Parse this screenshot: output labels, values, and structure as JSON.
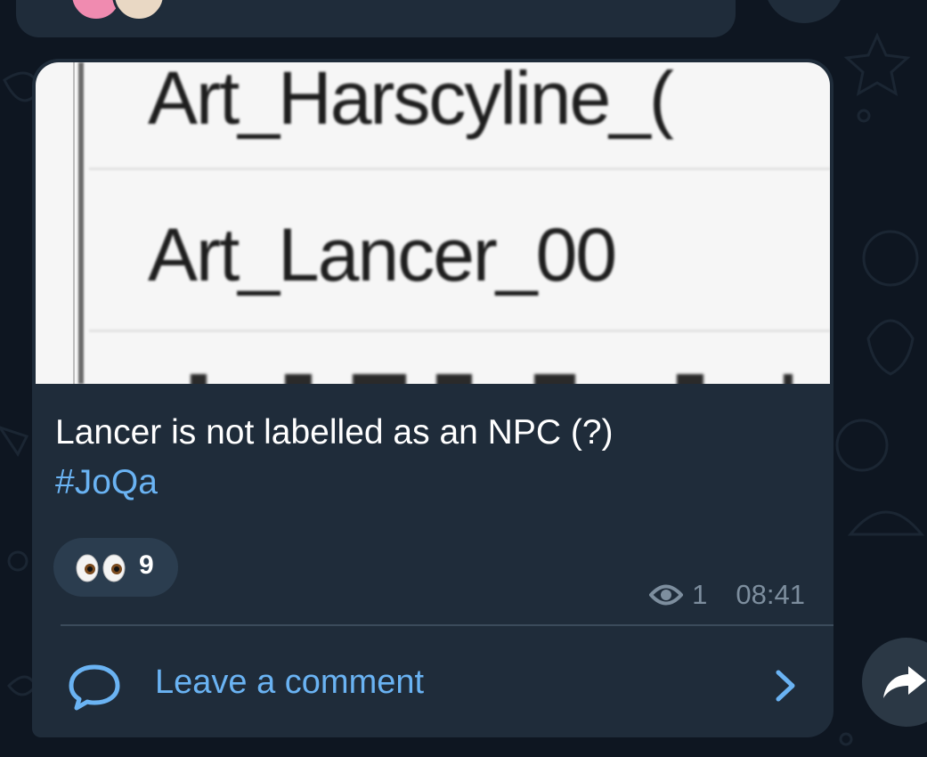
{
  "message": {
    "media_lines": [
      "Art_Harscyline_(",
      "Art_Lancer_00"
    ],
    "caption": "Lancer is not labelled as an NPC (?)",
    "hashtag": "#JoQa",
    "reaction": {
      "emoji": "eyes-emoji",
      "count": "9"
    },
    "views": "1",
    "time": "08:41",
    "comment_label": "Leave a comment"
  },
  "colors": {
    "background": "#0e1621",
    "bubble": "#1f2c3a",
    "accent": "#6ab3f3",
    "meta": "#7d8e9e"
  }
}
